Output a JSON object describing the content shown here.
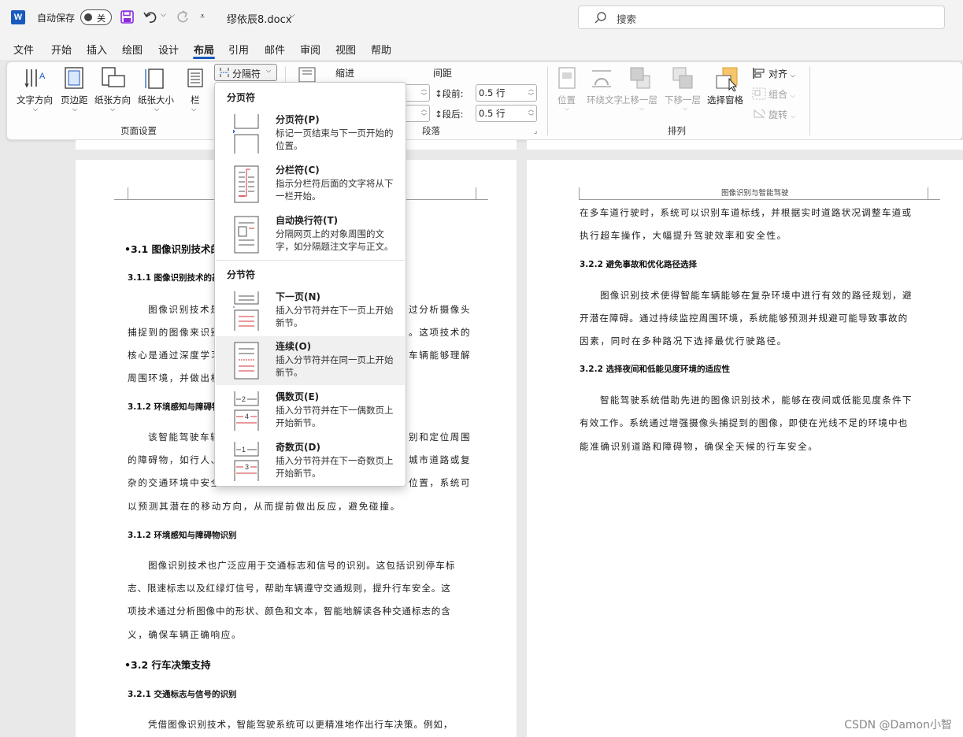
{
  "titlebar": {
    "autosave_label": "自动保存",
    "autosave_state": "关",
    "filename": "缪依辰8.docx",
    "search_placeholder": "搜索"
  },
  "menu_tabs": [
    "文件",
    "开始",
    "插入",
    "绘图",
    "设计",
    "布局",
    "引用",
    "邮件",
    "审阅",
    "视图",
    "帮助"
  ],
  "active_tab": "布局",
  "ribbon": {
    "page_setup": {
      "buttons": [
        "文字方向",
        "页边距",
        "纸张方向",
        "纸张大小",
        "栏"
      ],
      "breaks_button": "分隔符",
      "group_label": "页面设置"
    },
    "paragraph": {
      "indent_label": "缩进",
      "spacing_label": "间距",
      "before_label": "段前:",
      "before_value": "0.5 行",
      "after_label": "段后:",
      "after_value": "0.5 行",
      "group_label": "段落"
    },
    "arrange": {
      "position": "位置",
      "wrap_text": "环绕文字",
      "bring_forward": "上移一层",
      "send_backward": "下移一层",
      "selection_pane": "选择窗格",
      "align": "对齐",
      "group": "组合",
      "rotate": "旋转",
      "group_label": "排列"
    }
  },
  "dropdown": {
    "page_breaks_header": "分页符",
    "section_breaks_header": "分节符",
    "items": [
      {
        "title": "分页符(P)",
        "desc": "标记一页结束与下一页开始的位置。"
      },
      {
        "title": "分栏符(C)",
        "desc": "指示分栏符后面的文字将从下一栏开始。"
      },
      {
        "title": "自动换行符(T)",
        "desc": "分隔网页上的对象周围的文字，如分隔题注文字与正文。"
      },
      {
        "title": "下一页(N)",
        "desc": "插入分节符并在下一页上开始新节。"
      },
      {
        "title": "连续(O)",
        "desc": "插入分节符并在同一页上开始新节。"
      },
      {
        "title": "偶数页(E)",
        "desc": "插入分节符并在下一偶数页上开始新节。"
      },
      {
        "title": "奇数页(D)",
        "desc": "插入分节符并在下一奇数页上开始新节。"
      }
    ]
  },
  "left_page": {
    "h2_1": "3.1 图像识别技术的",
    "h3_1": "3.1.1 图像识别技术的基",
    "p1_lines": [
      "图像识别技术是",
      "捕捉到的图像来识别",
      "核心是通过深度学习",
      "周围环境，并做出相"
    ],
    "p1_right": [
      "过分析摄像头",
      "。这项技术的",
      "车辆能够理解"
    ],
    "h3_2": "3.1.2 环境感知与障碍物",
    "p2_lines": [
      "该智能驾驶车辆",
      "的障碍物，如行人、",
      "杂的交通环境中安全",
      "以预测其潜在的移动方向，从而提前做出反应，避免碰撞。"
    ],
    "p2_right": [
      "别和定位周围",
      "城市道路或复",
      "位置，系统可"
    ],
    "h3_3": "3.1.2 环境感知与障碍物识别",
    "p3_lines": [
      "图像识别技术也广泛应用于交通标志和信号的识别。这包括识别停车标",
      "志、限速标志以及红绿灯信号，帮助车辆遵守交通规则，提升行车安全。这",
      "项技术通过分析图像中的形状、颜色和文本，智能地解读各种交通标志的含",
      "义，确保车辆正确响应。"
    ],
    "h2_2": "3.2 行车决策支持",
    "h3_4": "3.2.1 交通标志与信号的识别",
    "p4_line": "凭借图像识别技术，智能驾驶系统可以更精准地作出行车决策。例如，"
  },
  "right_page": {
    "header": "图像识别与智能驾驶",
    "p1_lines": [
      "在多车道行驶时，系统可以识别车道标线，并根据实时道路状况调整车道或",
      "执行超车操作，大幅提升驾驶效率和安全性。"
    ],
    "h3_1": "3.2.2 避免事故和优化路径选择",
    "p2_lines": [
      "图像识别技术使得智能车辆能够在复杂环境中进行有效的路径规划，避",
      "开潜在障碍。通过持续监控周围环境，系统能够预测并规避可能导致事故的",
      "因素，同时在多种路况下选择最优行驶路径。"
    ],
    "h3_2": "3.2.2 选择夜间和低能见度环境的适应性",
    "p3_lines": [
      "智能驾驶系统借助先进的图像识别技术，能够在夜间或低能见度条件下",
      "有效工作。系统通过增强摄像头捕捉到的图像，即使在光线不足的环境中也",
      "能准确识别道路和障碍物，确保全天候的行车安全。"
    ]
  },
  "watermark": "CSDN @Damon小智",
  "colors": {
    "accent": "#185abd",
    "background": "#e9e9e9",
    "ribbon": "#fdfdfd"
  }
}
